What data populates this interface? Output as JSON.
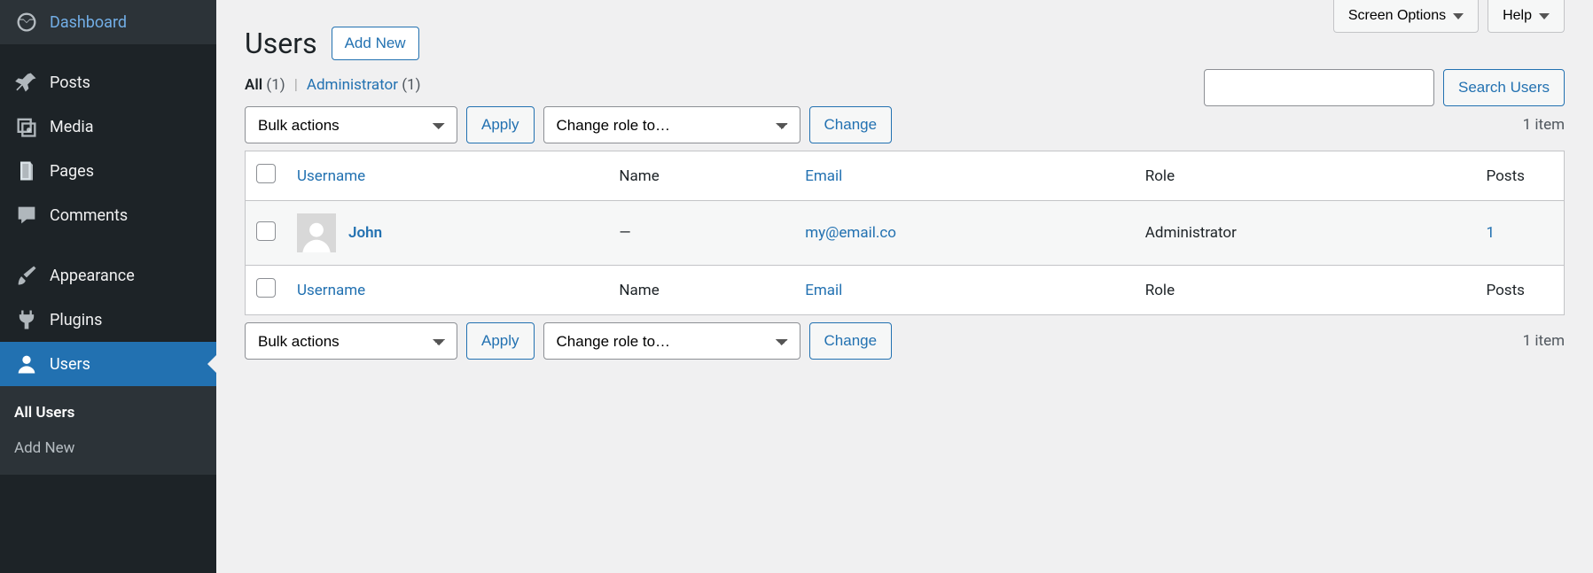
{
  "sidebar": {
    "items": [
      {
        "label": "Dashboard",
        "icon": "dashboard"
      },
      {
        "label": "Posts",
        "icon": "pin"
      },
      {
        "label": "Media",
        "icon": "media"
      },
      {
        "label": "Pages",
        "icon": "pages"
      },
      {
        "label": "Comments",
        "icon": "comment"
      },
      {
        "label": "Appearance",
        "icon": "brush"
      },
      {
        "label": "Plugins",
        "icon": "plug"
      },
      {
        "label": "Users",
        "icon": "user"
      }
    ],
    "submenu": [
      {
        "label": "All Users"
      },
      {
        "label": "Add New"
      }
    ]
  },
  "top": {
    "screen_options": "Screen Options",
    "help": "Help"
  },
  "header": {
    "title": "Users",
    "add_new": "Add New"
  },
  "filters": {
    "all_label": "All",
    "all_count": "(1)",
    "admin_label": "Administrator",
    "admin_count": "(1)"
  },
  "search": {
    "button": "Search Users"
  },
  "bulk": {
    "actions_label": "Bulk actions",
    "apply": "Apply",
    "role_label": "Change role to…",
    "change": "Change"
  },
  "pagination": {
    "items": "1 item"
  },
  "table": {
    "cols": {
      "username": "Username",
      "name": "Name",
      "email": "Email",
      "role": "Role",
      "posts": "Posts"
    },
    "rows": [
      {
        "username": "John",
        "name": "—",
        "email": "my@email.co",
        "role": "Administrator",
        "posts": "1"
      }
    ]
  }
}
